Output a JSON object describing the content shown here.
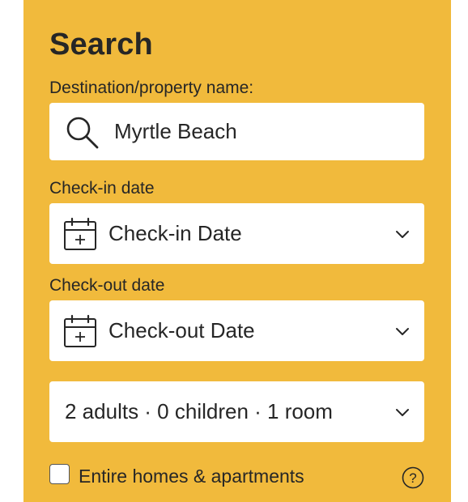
{
  "search": {
    "title": "Search",
    "destination_label": "Destination/property name:",
    "destination_value": "Myrtle Beach",
    "checkin_label": "Check-in date",
    "checkin_value": "Check-in Date",
    "checkout_label": "Check-out date",
    "checkout_value": "Check-out Date",
    "guests_value": "2 adults · 0 children · 1 room",
    "entire_homes_label": "Entire homes & apartments",
    "entire_homes_checked": false
  },
  "colors": {
    "panel_background": "#f1ba3c",
    "field_background": "#ffffff",
    "text": "#262626"
  },
  "icons": {
    "destination": "search-icon",
    "checkin": "calendar-icon",
    "checkout": "calendar-icon",
    "dropdown": "chevron-down-icon",
    "help": "question-circle-icon"
  }
}
